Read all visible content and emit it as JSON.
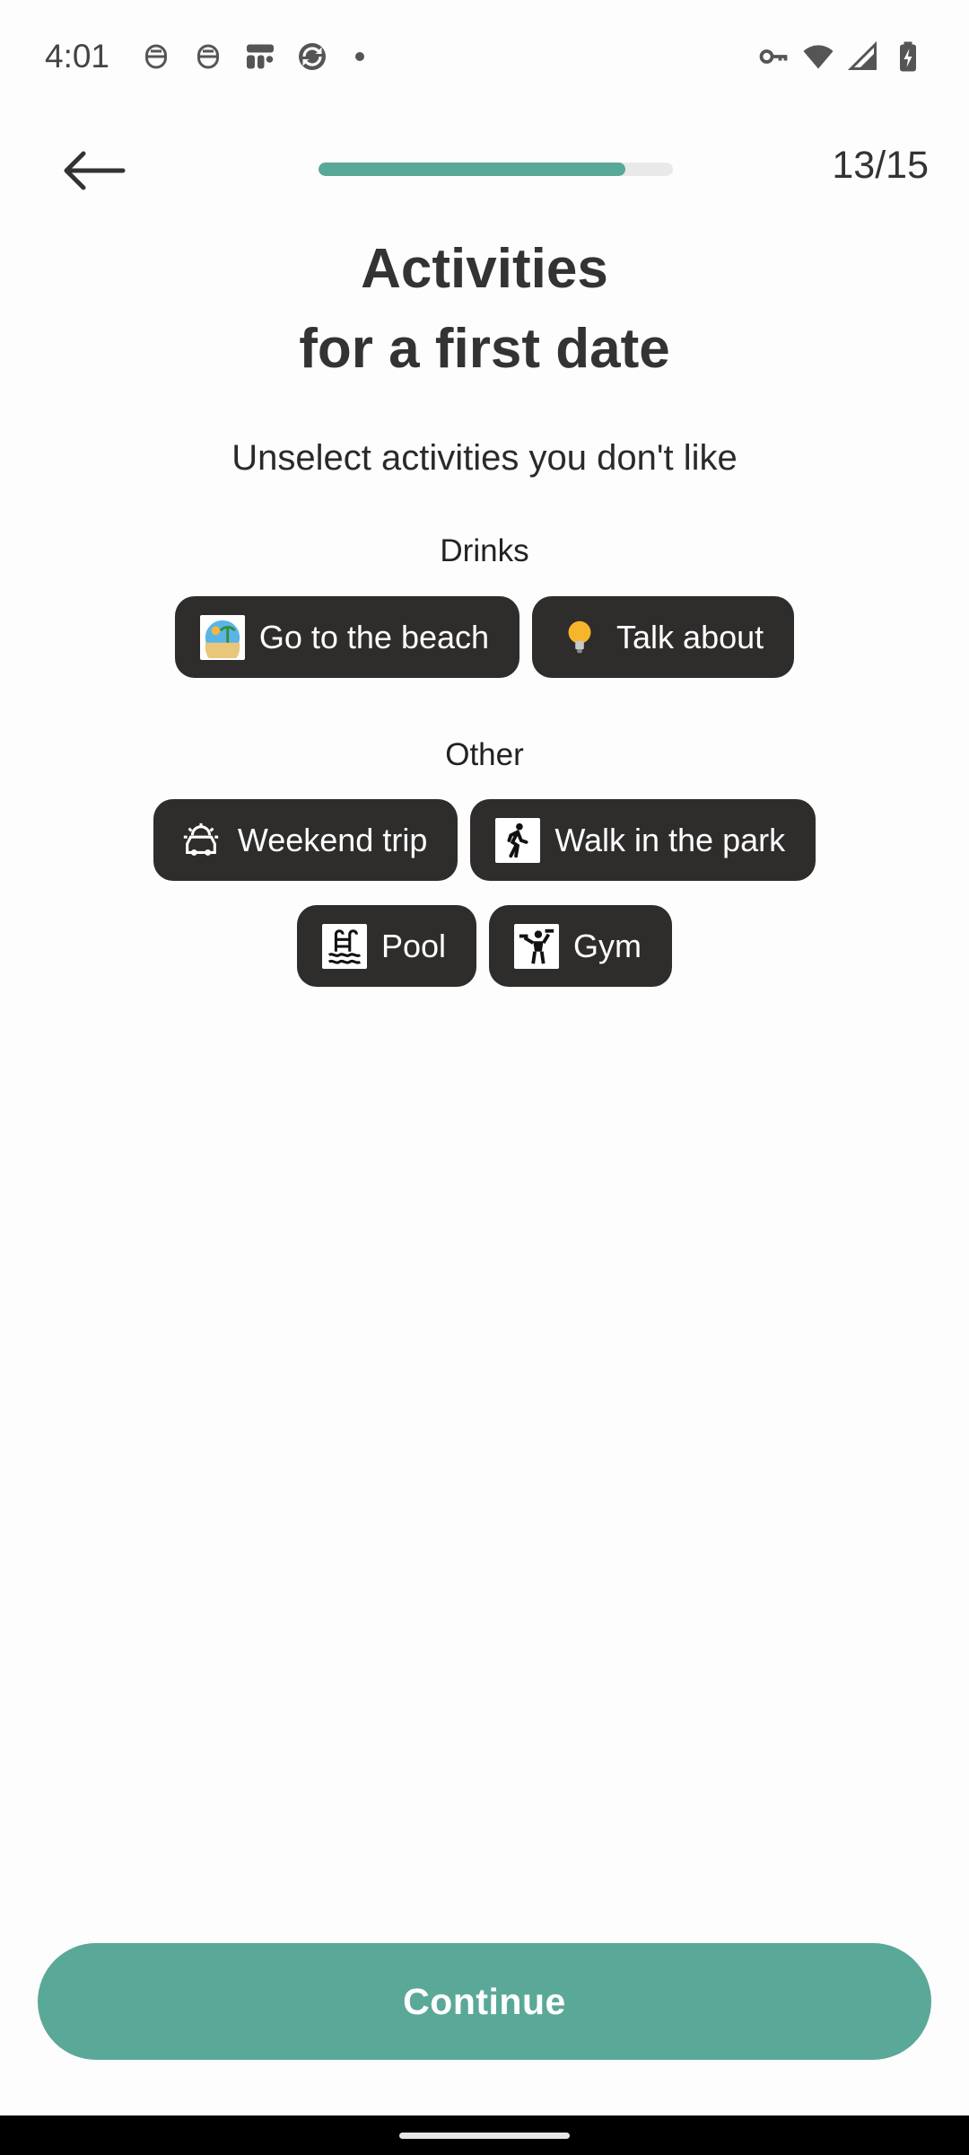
{
  "status_bar": {
    "time": "4:01",
    "left_icons": [
      "notification-icon",
      "notification-icon",
      "app-icon",
      "sync-icon",
      "dot-icon"
    ],
    "right_icons": [
      "vpn-key-icon",
      "wifi-icon",
      "signal-icon",
      "battery-charging-icon"
    ]
  },
  "header": {
    "step_counter": "13/15",
    "progress_fraction": 0.867,
    "progress_color": "#5aa898"
  },
  "page": {
    "title_line1": "Activities",
    "title_line2": "for a first date",
    "subtitle": "Unselect activities you don't like"
  },
  "sections": [
    {
      "label": "Drinks",
      "items": [
        {
          "label": "Go to the beach",
          "icon": "beach-icon"
        },
        {
          "label": "Talk about",
          "icon": "lightbulb-icon"
        }
      ]
    },
    {
      "label": "Other",
      "items": [
        {
          "label": "Weekend trip",
          "icon": "car-sun-icon"
        },
        {
          "label": "Walk in the park",
          "icon": "walking-person-icon"
        },
        {
          "label": "Pool",
          "icon": "pool-icon"
        },
        {
          "label": "Gym",
          "icon": "gym-icon"
        }
      ]
    }
  ],
  "footer": {
    "continue_label": "Continue",
    "accent_color": "#5aa898",
    "chip_color": "#2e2d2c"
  }
}
